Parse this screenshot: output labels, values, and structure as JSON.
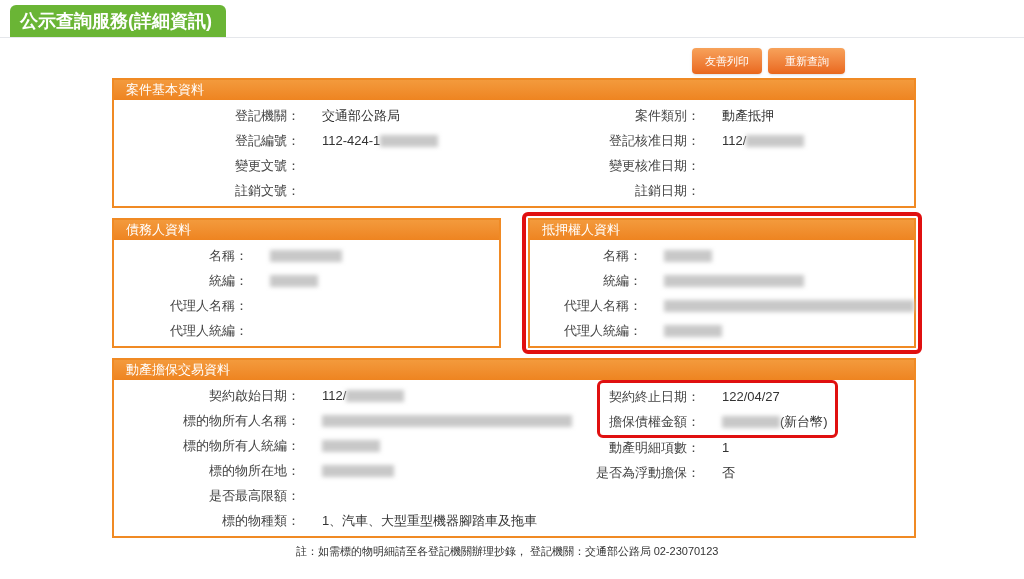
{
  "page_tab": {
    "title": "公示查詢服務(詳細資訊)"
  },
  "buttons": [
    "友善列印",
    "重新查詢"
  ],
  "sections": [
    {
      "title": "案件基本資料",
      "kind": "full",
      "highlighted": false,
      "columns": [
        {
          "fields": [
            {
              "label": "登記機關：",
              "value": "交通部公路局",
              "redacted": false,
              "highlighted": false
            },
            {
              "label": "登記編號：",
              "value": "112-424-1",
              "redacted": true,
              "highlighted": false
            },
            {
              "label": "變更文號：",
              "redacted": false,
              "highlighted": false
            },
            {
              "label": "註銷文號：",
              "redacted": false,
              "highlighted": false
            }
          ]
        },
        {
          "fields": [
            {
              "label": "案件類別：",
              "value": "動產抵押",
              "redacted": false,
              "highlighted": false
            },
            {
              "label": "登記核准日期：",
              "value": "112/",
              "redacted": true,
              "highlighted": false
            },
            {
              "label": "變更核准日期：",
              "redacted": false,
              "highlighted": false
            },
            {
              "label": "註銷日期：",
              "redacted": false,
              "highlighted": false
            }
          ]
        }
      ]
    },
    {
      "title": "債務人資料",
      "kind": "half",
      "highlighted": false,
      "columns": [
        {
          "fields": [
            {
              "label": "名稱：",
              "redacted": true,
              "highlighted": false
            },
            {
              "label": "統編：",
              "redacted": true,
              "highlighted": false
            },
            {
              "label": "代理人名稱：",
              "redacted": false,
              "highlighted": false
            },
            {
              "label": "代理人統編：",
              "redacted": false,
              "highlighted": false
            }
          ]
        }
      ]
    },
    {
      "title": "抵押權人資料",
      "kind": "half",
      "highlighted": true,
      "columns": [
        {
          "fields": [
            {
              "label": "名稱：",
              "redacted": true,
              "highlighted": false
            },
            {
              "label": "統編：",
              "redacted": true,
              "highlighted": false
            },
            {
              "label": "代理人名稱：",
              "redacted": true,
              "highlighted": false
            },
            {
              "label": "代理人統編：",
              "redacted": true,
              "highlighted": false
            }
          ]
        }
      ]
    },
    {
      "title": "動產擔保交易資料",
      "kind": "full",
      "highlighted": false,
      "columns": [
        {
          "fields": [
            {
              "label": "契約啟始日期：",
              "value": "112/",
              "redacted": true,
              "highlighted": false
            },
            {
              "label": "標的物所有人名稱：",
              "redacted": true,
              "highlighted": false
            },
            {
              "label": "標的物所有人統編：",
              "redacted": true,
              "highlighted": false
            },
            {
              "label": "標的物所在地：",
              "redacted": true,
              "highlighted": false
            },
            {
              "label": "是否最高限額：",
              "redacted": false,
              "highlighted": false
            },
            {
              "label": "標的物種類：",
              "value": "1、汽車、大型重型機器腳踏車及拖車",
              "redacted": false,
              "highlighted": false
            }
          ]
        },
        {
          "fields": [
            {
              "label": "契約終止日期：",
              "value": "122/04/27",
              "redacted": false,
              "highlighted": true
            },
            {
              "label": "擔保債權金額：",
              "value": "(新台幣)",
              "redacted": true,
              "highlighted": true
            },
            {
              "label": "動產明細項數：",
              "value": "1",
              "redacted": false,
              "highlighted": false
            },
            {
              "label": "是否為浮動擔保：",
              "value": "否",
              "redacted": false,
              "highlighted": false
            }
          ]
        }
      ]
    }
  ],
  "footnote": "註：如需標的物明細請至各登記機關辦理抄錄， 登記機關：交通部公路局 02-23070123"
}
